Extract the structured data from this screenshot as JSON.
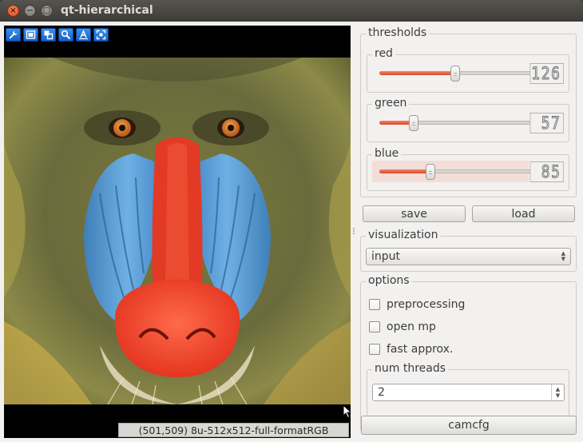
{
  "window": {
    "title": "qt-hierarchical",
    "close_glyph": "×",
    "minimize_glyph": "−",
    "maximize_glyph": "□"
  },
  "viewer": {
    "toolbar_icons": [
      "wrench-icon",
      "fit-window-icon",
      "zoom-original-icon",
      "zoom-icon",
      "text-overlay-icon",
      "fullscreen-icon"
    ],
    "status": "(501,509) 8u-512x512-full-formatRGB",
    "image_subject": "mandrill-face"
  },
  "thresholds": {
    "title": "thresholds",
    "red": {
      "label": "red",
      "value": "126",
      "fraction": 0.494
    },
    "green": {
      "label": "green",
      "value": "57",
      "fraction": 0.224
    },
    "blue": {
      "label": "blue",
      "value": "85",
      "fraction": 0.333
    }
  },
  "buttons": {
    "save": "save",
    "load": "load",
    "camcfg": "camcfg"
  },
  "visualization": {
    "title": "visualization",
    "selected": "input"
  },
  "options": {
    "title": "options",
    "preprocessing": "preprocessing",
    "open_mp": "open mp",
    "fast_approx": "fast approx.",
    "num_threads_label": "num threads",
    "num_threads_value": "2"
  },
  "colors": {
    "accent": "#df4a16",
    "slider_fill": "#e2593a",
    "toolbar_blue": "#1f6fd6"
  }
}
